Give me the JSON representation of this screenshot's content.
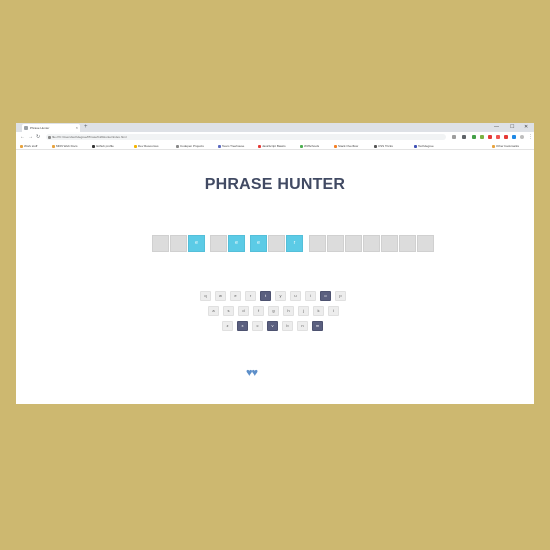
{
  "browser": {
    "tab_title": "Phrase Hunter",
    "new_tab_symbol": "+",
    "close_symbol": "×",
    "window_controls": {
      "minimize": "—",
      "maximize": "☐",
      "close": "✕"
    },
    "nav": {
      "back": "←",
      "forward": "→",
      "reload": "↻"
    },
    "url": "file:///C:/Users/techdegree/Phrase%20Hunter/index.html",
    "menu": "⋮",
    "bookmarks": [
      {
        "label": "Work stuff",
        "color": "#e8a33d"
      },
      {
        "label": "MDN Web Docs",
        "color": "#e8a33d"
      },
      {
        "label": "Github profile",
        "color": "#333333"
      },
      {
        "label": "Dev Resources",
        "color": "#f4b400"
      },
      {
        "label": "Codepen Projects",
        "color": "#888888"
      },
      {
        "label": "Team Treehouse",
        "color": "#5c6bc0"
      },
      {
        "label": "JavaScript Basics",
        "color": "#e53935"
      },
      {
        "label": "W3Schools",
        "color": "#4caf50"
      },
      {
        "label": "Stack Overflow",
        "color": "#f48024"
      },
      {
        "label": "CSS Tricks",
        "color": "#555555"
      },
      {
        "label": "Techdegree",
        "color": "#3f51b5"
      },
      {
        "label": "Other bookmarks",
        "color": "#e8a33d"
      }
    ]
  },
  "game": {
    "title": "PHRASE HUNTER",
    "phrase_tiles": [
      {
        "char": "",
        "shown": false
      },
      {
        "char": "",
        "shown": false
      },
      {
        "char": "e",
        "shown": true
      },
      {
        "char": "",
        "shown": false
      },
      {
        "char": "e",
        "shown": true
      },
      {
        "char": "e",
        "shown": true
      },
      {
        "char": "",
        "shown": false
      },
      {
        "char": "r",
        "shown": true
      },
      {
        "char": "",
        "shown": false
      },
      {
        "char": "",
        "shown": false
      },
      {
        "char": "",
        "shown": false
      },
      {
        "char": "",
        "shown": false
      },
      {
        "char": "",
        "shown": false
      },
      {
        "char": "",
        "shown": false
      },
      {
        "char": "",
        "shown": false
      }
    ],
    "keyboard": [
      [
        {
          "key": "q",
          "chosen": false
        },
        {
          "key": "w",
          "chosen": false
        },
        {
          "key": "e",
          "chosen": false
        },
        {
          "key": "r",
          "chosen": false
        },
        {
          "key": "t",
          "chosen": true
        },
        {
          "key": "y",
          "chosen": false
        },
        {
          "key": "u",
          "chosen": false
        },
        {
          "key": "i",
          "chosen": false
        },
        {
          "key": "o",
          "chosen": true
        },
        {
          "key": "p",
          "chosen": false
        }
      ],
      [
        {
          "key": "a",
          "chosen": false
        },
        {
          "key": "s",
          "chosen": false
        },
        {
          "key": "d",
          "chosen": false
        },
        {
          "key": "f",
          "chosen": false
        },
        {
          "key": "g",
          "chosen": false
        },
        {
          "key": "h",
          "chosen": false
        },
        {
          "key": "j",
          "chosen": false
        },
        {
          "key": "k",
          "chosen": false
        },
        {
          "key": "l",
          "chosen": false
        }
      ],
      [
        {
          "key": "z",
          "chosen": false
        },
        {
          "key": "x",
          "chosen": true
        },
        {
          "key": "c",
          "chosen": false
        },
        {
          "key": "v",
          "chosen": true
        },
        {
          "key": "b",
          "chosen": false
        },
        {
          "key": "n",
          "chosen": false
        },
        {
          "key": "m",
          "chosen": true
        }
      ]
    ],
    "lives_display": "♥♥",
    "colors": {
      "revealed": "#5ccbe6",
      "chosen_key": "#5a5f7f",
      "heart": "#5d8fc9",
      "title": "#414a63"
    }
  }
}
